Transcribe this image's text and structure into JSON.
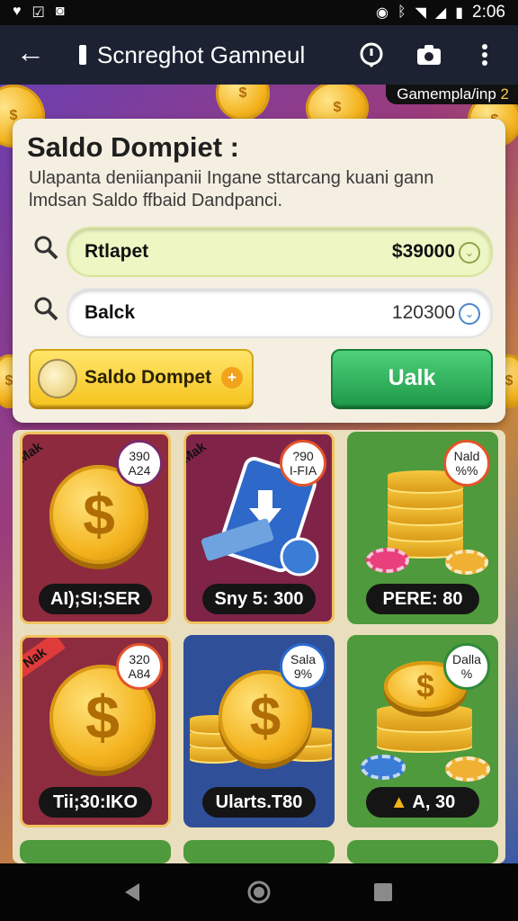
{
  "status_bar": {
    "time": "2:06"
  },
  "app_bar": {
    "back_icon": "arrow-left-icon",
    "title": "Scnreghot Gamneul"
  },
  "pill": {
    "text": "Gamempla/inp",
    "num": "2"
  },
  "wallet": {
    "title": "Saldo Dompiet :",
    "description": "Ulapanta deniianpanii Ingane sttarcang kuani gann lmdsan Saldo ffbaid Dandpanci.",
    "rows": [
      {
        "label": "Rtlapet",
        "value": "$39000"
      },
      {
        "label": "Balck",
        "value": "120300"
      }
    ],
    "saldo_button": "Saldo Dompet",
    "action_button": "Ualk"
  },
  "cards": [
    {
      "ribbon": "Mak",
      "badge_top": "390",
      "badge_bottom": "A24",
      "price": "AI);SI;SER",
      "bg": "#8e2a3e"
    },
    {
      "ribbon": "Mak",
      "badge_top": "?90",
      "badge_bottom": "I-FIA",
      "price": "Sny 5: 300",
      "bg": "#7f2448"
    },
    {
      "ribbon": "",
      "badge_top": "Nald",
      "badge_bottom": "%%",
      "price": "PERE: 80",
      "bg": "#4e9a3c"
    },
    {
      "ribbon": "Nak",
      "badge_top": "320",
      "badge_bottom": "A84",
      "price": "Tii;30:IKO",
      "bg": "#8d2b3f"
    },
    {
      "ribbon": "",
      "badge_top": "Sala",
      "badge_bottom": "9%",
      "price": "Ularts.T80",
      "bg": "#2f4f99"
    },
    {
      "ribbon": "",
      "badge_top": "Dalla",
      "badge_bottom": "%",
      "price": "A, 30",
      "bg": "#4e9a3c"
    }
  ]
}
